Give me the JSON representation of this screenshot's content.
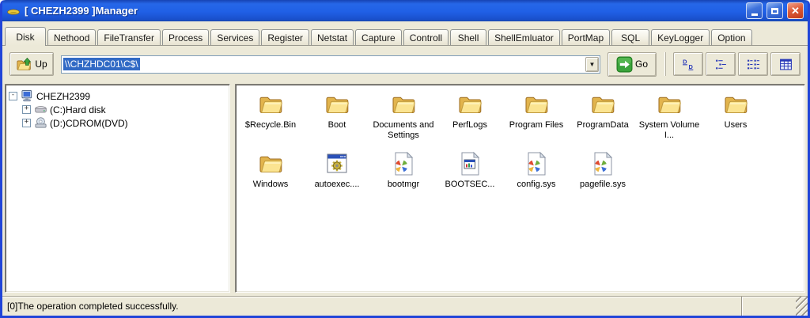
{
  "window": {
    "title": "[ CHEZH2399 ]Manager",
    "app_icon": "ufo-icon",
    "controls": [
      "minimize-button",
      "maximize-button",
      "close-button"
    ],
    "close_glyph": "✕"
  },
  "tabs": {
    "items": [
      "Disk",
      "Nethood",
      "FileTransfer",
      "Process",
      "Services",
      "Register",
      "Netstat",
      "Capture",
      "Controll",
      "Shell",
      "ShellEmluator",
      "PortMap",
      "SQL",
      "KeyLogger",
      "Option"
    ],
    "active": "Disk"
  },
  "toolbar": {
    "up_label": "Up",
    "address_value": "\\\\CHZHDC01\\C$\\",
    "dropdown_glyph": "▼",
    "go_label": "Go",
    "view_buttons": [
      {
        "name": "large-icons-view-button",
        "icon": "view-large"
      },
      {
        "name": "small-icons-view-button",
        "icon": "view-small"
      },
      {
        "name": "list-view-button",
        "icon": "view-list"
      },
      {
        "name": "details-view-button",
        "icon": "view-details"
      }
    ]
  },
  "tree": {
    "root": {
      "label": "CHEZH2399",
      "expander": "-",
      "icon": "computer"
    },
    "children": [
      {
        "label": "(C:)Hard disk",
        "expander": "+",
        "icon": "harddisk"
      },
      {
        "label": "(D:)CDROM(DVD)",
        "expander": "+",
        "icon": "cdrom"
      }
    ]
  },
  "files": {
    "items": [
      {
        "name": "$Recycle.Bin",
        "icon": "folder"
      },
      {
        "name": "Boot",
        "icon": "folder"
      },
      {
        "name": "Documents and Settings",
        "icon": "folder"
      },
      {
        "name": "PerfLogs",
        "icon": "folder"
      },
      {
        "name": "Program Files",
        "icon": "folder"
      },
      {
        "name": "ProgramData",
        "icon": "folder"
      },
      {
        "name": "System Volume I...",
        "icon": "folder"
      },
      {
        "name": "Users",
        "icon": "folder"
      },
      {
        "name": "Windows",
        "icon": "folder"
      },
      {
        "name": "autoexec....",
        "icon": "batch"
      },
      {
        "name": "bootmgr",
        "icon": "sysfile"
      },
      {
        "name": "BOOTSEC...",
        "icon": "appfile"
      },
      {
        "name": "config.sys",
        "icon": "sysfile"
      },
      {
        "name": "pagefile.sys",
        "icon": "sysfile"
      }
    ]
  },
  "statusbar": {
    "message": "[0]The operation completed successfully."
  },
  "colors": {
    "titlebar_blue": "#2060E6",
    "window_border": "#2145D8",
    "chrome_beige": "#ECE9D8",
    "selection_blue": "#316AC5",
    "close_red": "#DD5B38",
    "folder_yellow": "#FBE491",
    "go_green": "#3BA33B"
  }
}
